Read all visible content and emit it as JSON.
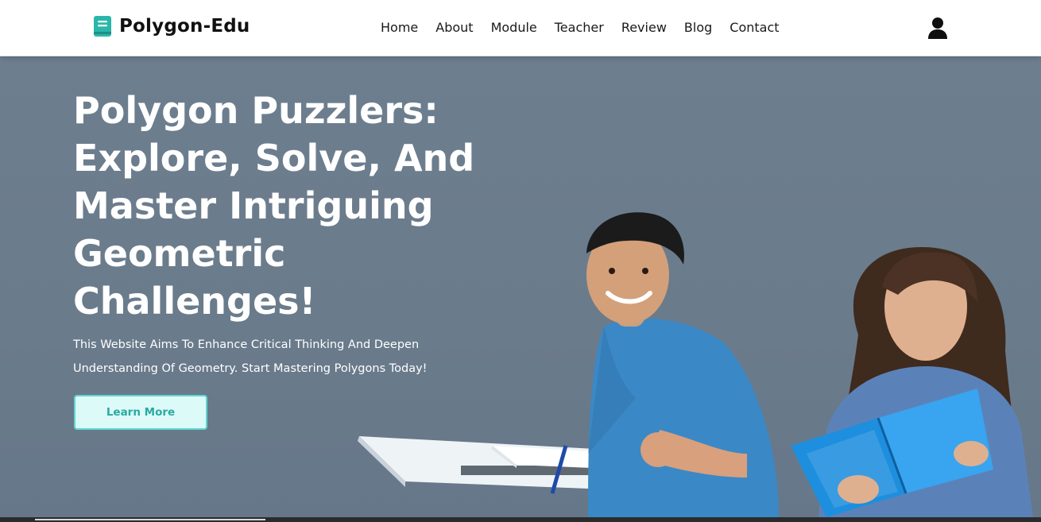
{
  "brand": {
    "name": "Polygon-Edu",
    "icon": "book-icon"
  },
  "nav": {
    "items": [
      {
        "label": "Home"
      },
      {
        "label": "About"
      },
      {
        "label": "Module"
      },
      {
        "label": "Teacher"
      },
      {
        "label": "Review"
      },
      {
        "label": "Blog"
      },
      {
        "label": "Contact"
      }
    ],
    "user_icon": "user-icon"
  },
  "hero": {
    "title": "Polygon Puzzlers: Explore, Solve, And Master Intriguing Geometric Challenges!",
    "subtitle": "This Website Aims To Enhance Critical Thinking And Deepen Understanding Of Geometry. Start Mastering Polygons Today!",
    "cta_label": "Learn More",
    "image_icon": "students-illustration"
  },
  "colors": {
    "accent": "#2ab7a9",
    "hero_bg": "#6b7c8c",
    "cta_bg": "#dcfbf8",
    "cta_text": "#2aa9a1"
  }
}
